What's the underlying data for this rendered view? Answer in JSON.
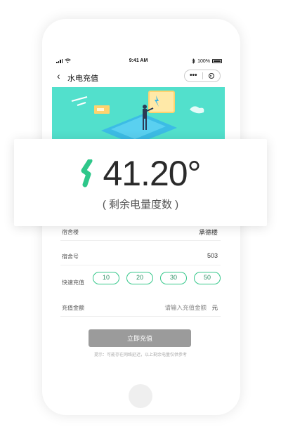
{
  "status_bar": {
    "time": "9:41 AM",
    "battery": "100%",
    "icons": [
      "signal-icon",
      "wifi-icon",
      "bluetooth-icon",
      "battery-icon"
    ]
  },
  "nav": {
    "title": "水电充值",
    "back_icon": "chevron-left-icon",
    "menu_icon": "more-dots-icon",
    "close_icon": "target-circle-icon"
  },
  "reading": {
    "value": "41.20°",
    "caption": "( 剩余电量度数 )",
    "icon": "lightning-bolt-icon",
    "icon_color": "#2ec78a"
  },
  "form": {
    "building_label": "宿舍楼",
    "building_value": "承德楼",
    "room_label": "宿舍号",
    "room_value": "503",
    "quick_label": "快速充值",
    "quick_amounts": [
      "10",
      "20",
      "30",
      "50"
    ],
    "amount_label": "充值金额",
    "amount_placeholder": "请输入充值金额",
    "amount_unit": "元"
  },
  "submit_label": "立即充值",
  "tip": "提示：可能存在网络延迟，以上剩余电量仅供参考",
  "colors": {
    "banner": "#52e0cc",
    "accent": "#35c78a",
    "button": "#9b9b9b"
  }
}
